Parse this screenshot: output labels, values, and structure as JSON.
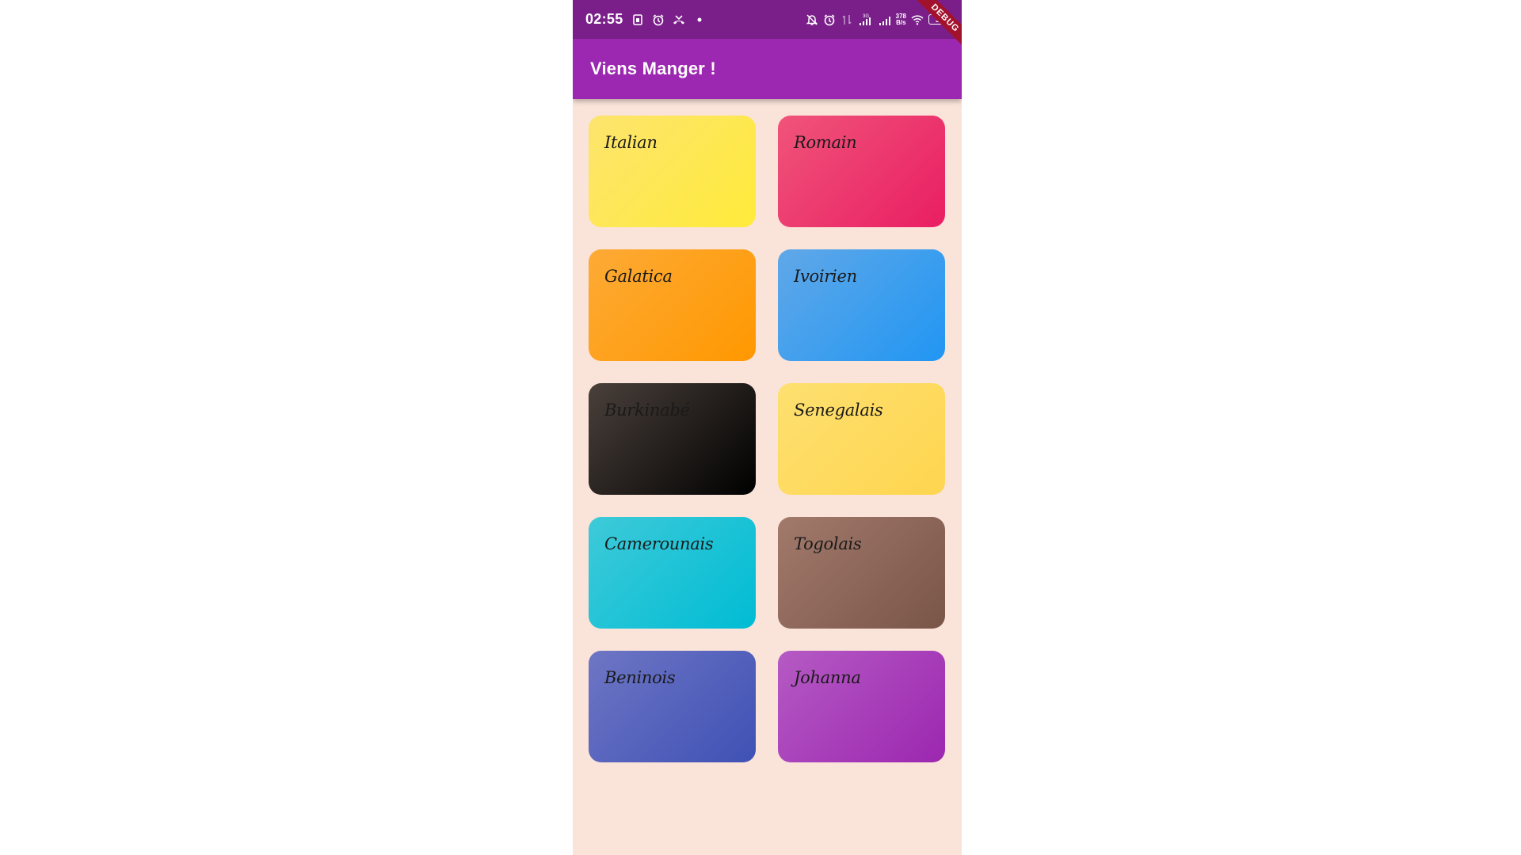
{
  "status_bar": {
    "time": "02:55",
    "network_speed_top": "378",
    "network_speed_bottom": "B/s",
    "network_type": "3G",
    "battery": "30",
    "left_icons": [
      "sim-card-icon",
      "alarm-icon",
      "missed-call-icon",
      "dot-icon"
    ],
    "right_icons": [
      "bell-off-icon",
      "alarm-icon",
      "data-arrows-icon",
      "signal-icon",
      "signal-icon",
      "wifi-icon",
      "battery-icon"
    ]
  },
  "app_bar": {
    "title": "Viens Manger !",
    "background": "#9c27b0"
  },
  "debug_banner": {
    "label": "DEBUG"
  },
  "categories": [
    {
      "label": "Italian",
      "color_start": "#fde46e",
      "color_end": "#ffeb3b"
    },
    {
      "label": "Romain",
      "color_start": "#f0547a",
      "color_end": "#e91e63"
    },
    {
      "label": "Galatica",
      "color_start": "#fdaa36",
      "color_end": "#ff9800"
    },
    {
      "label": "Ivoirien",
      "color_start": "#60a8e8",
      "color_end": "#2196f3"
    },
    {
      "label": "Burkinabé",
      "color_start": "#4a403b",
      "color_end": "#000000"
    },
    {
      "label": "Senegalais",
      "color_start": "#fde070",
      "color_end": "#ffd54f"
    },
    {
      "label": "Camerounais",
      "color_start": "#3ecad9",
      "color_end": "#00bcd4"
    },
    {
      "label": "Togolais",
      "color_start": "#a27a6c",
      "color_end": "#795548"
    },
    {
      "label": "Beninois",
      "color_start": "#6e76c4",
      "color_end": "#3f51b5"
    },
    {
      "label": "Johanna",
      "color_start": "#b55ac4",
      "color_end": "#9c27b0"
    }
  ],
  "page_background": "#fae3d9"
}
